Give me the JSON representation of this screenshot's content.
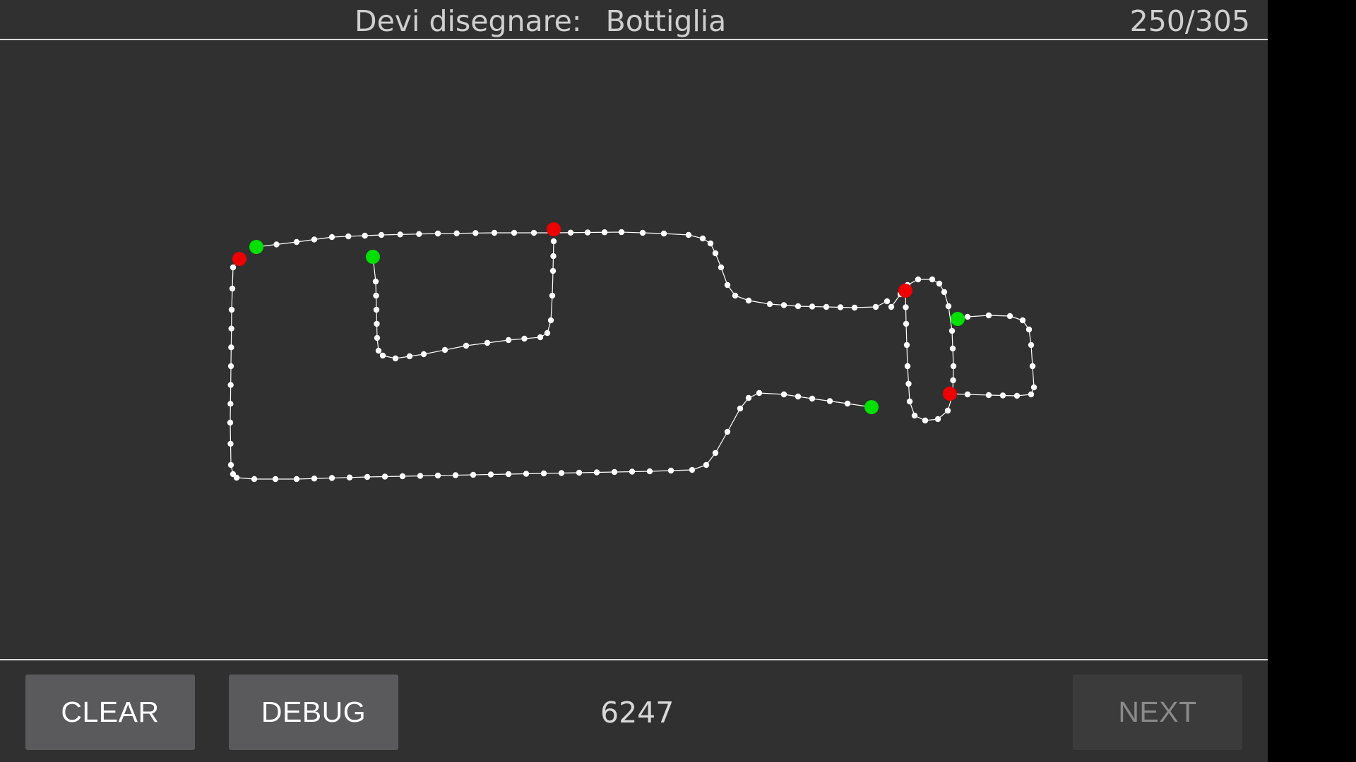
{
  "header": {
    "prompt_label": "Devi disegnare:",
    "target_word": "Bottiglia",
    "progress_text": "250/305"
  },
  "footer": {
    "clear_label": "CLEAR",
    "debug_label": "DEBUG",
    "score": "6247",
    "next_label": "NEXT",
    "next_enabled": false
  },
  "colors": {
    "background": "#303030",
    "stroke": "#ffffff",
    "stroke_start": "#00e000",
    "stroke_end": "#ee0000"
  }
}
